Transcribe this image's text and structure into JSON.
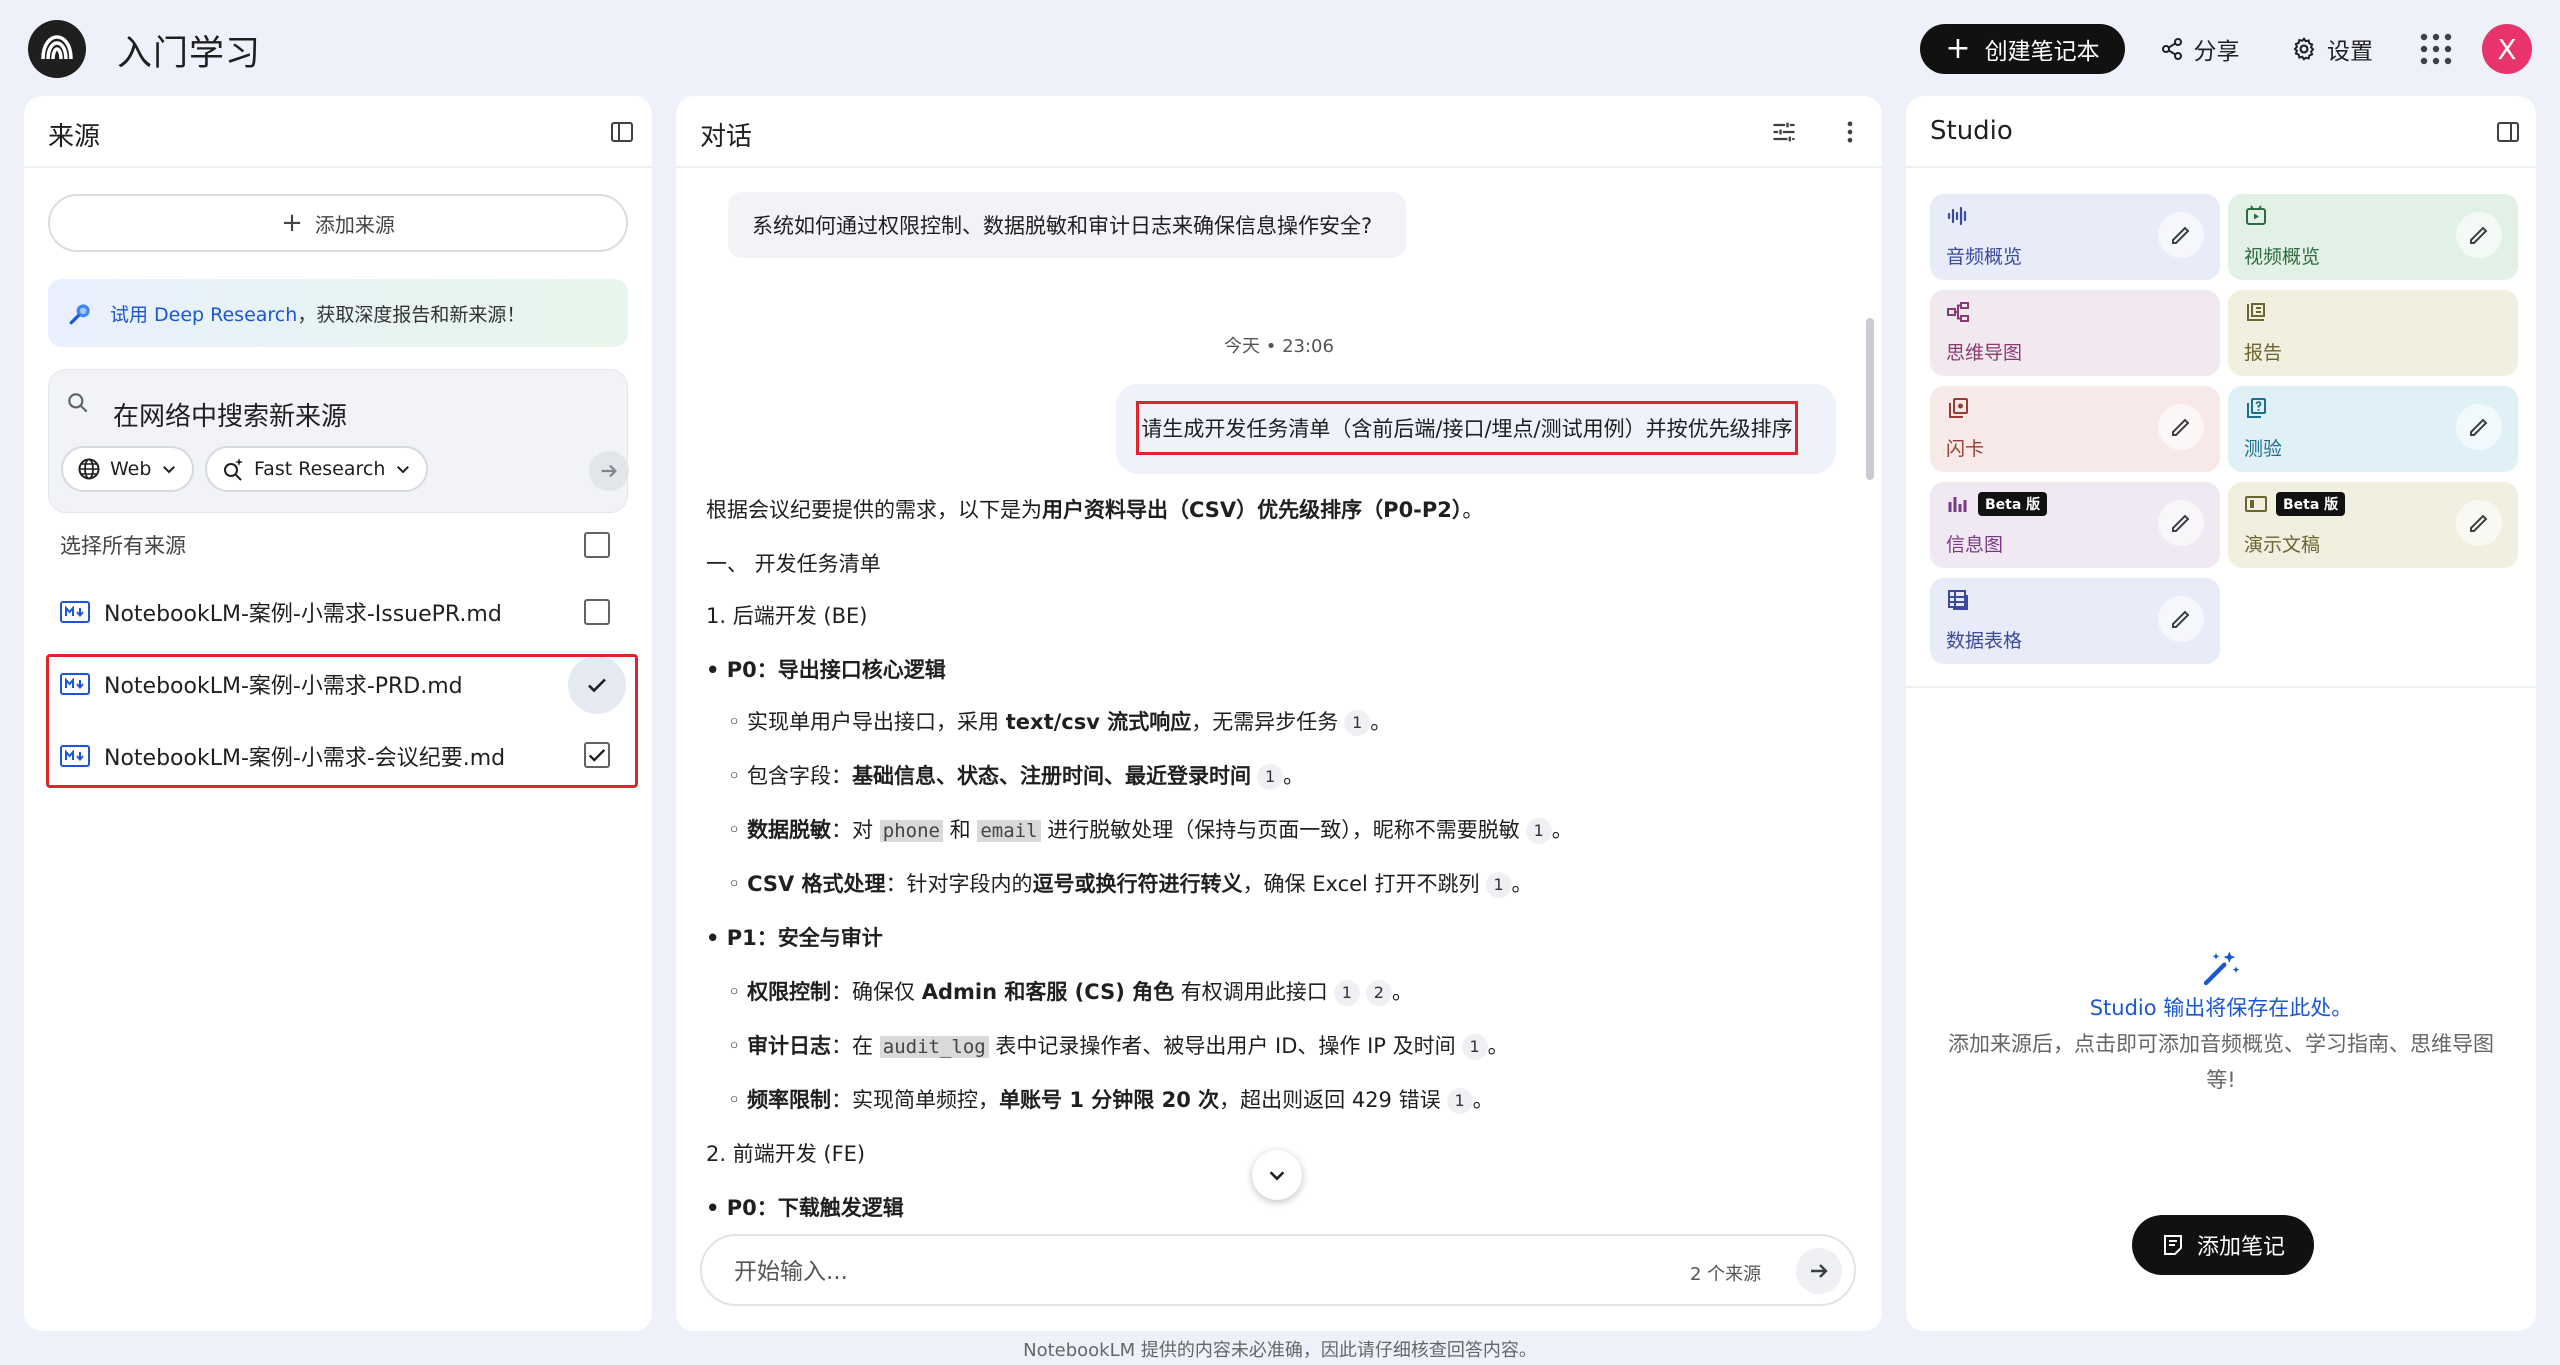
{
  "header": {
    "notebook_title": "入门学习",
    "create_label": "创建笔记本",
    "share_label": "分享",
    "settings_label": "设置",
    "avatar_letter": "X"
  },
  "sources": {
    "title": "来源",
    "add_label": "添加来源",
    "deep_link": "试用 Deep Research",
    "deep_text": "，获取深度报告和新来源！",
    "search_placeholder": "在网络中搜索新来源",
    "chip_web": "Web",
    "chip_research": "Fast Research",
    "select_all": "选择所有来源",
    "items": [
      {
        "name": "NotebookLM-案例-小需求-IssuePR.md",
        "checked": false
      },
      {
        "name": "NotebookLM-案例-小需求-PRD.md",
        "checked": true
      },
      {
        "name": "NotebookLM-案例-小需求-会议纪要.md",
        "checked": true
      }
    ]
  },
  "chat": {
    "title": "对话",
    "user_q1": "系统如何通过权限控制、数据脱敏和审计日志来确保信息操作安全?",
    "timestamp": "今天 • 23:06",
    "user_q2": "请生成开发任务清单（含前后端/接口/埋点/测试用例）并按优先级排序",
    "answer": {
      "intro_pre": "根据会议纪要提供的需求，以下是为",
      "intro_bold": "用户资料导出（CSV）优先级排序（P0-P2）",
      "intro_post": "。",
      "sec1": "一、 开发任务清单",
      "sub1": "1. 后端开发 (BE)",
      "p0": "• P0：导出接口核心逻辑",
      "p0_items": {
        "a_pre": "◦ 实现单用户导出接口，采用 ",
        "a_bold": "text/csv 流式响应",
        "a_post": "，无需异步任务",
        "b_pre": "◦ 包含字段：",
        "b_bold": "基础信息、状态、注册时间、最近登录时间",
        "c_bold": "数据脱敏",
        "c_pre": "：对 ",
        "c_code1": "phone",
        "c_mid": " 和 ",
        "c_code2": "email",
        "c_post": " 进行脱敏处理（保持与页面一致），昵称不需要脱敏",
        "d_bold": "CSV 格式处理",
        "d_pre": "：针对字段内的",
        "d_bold2": "逗号或换行符进行转义",
        "d_post": "，确保 Excel 打开不跳列"
      },
      "p1": "• P1：安全与审计",
      "p1_items": {
        "a_bold": "权限控制",
        "a_pre": "：确保仅 ",
        "a_bold2": "Admin 和客服 (CS) 角色",
        "a_post": " 有权调用此接口",
        "b_bold": "审计日志",
        "b_pre": "：在 ",
        "b_code": "audit_log",
        "b_post": " 表中记录操作者、被导出用户 ID、操作 IP 及时间",
        "c_bold": "频率限制",
        "c_pre": "：实现简单频控，",
        "c_bold2": "单账号 1 分钟限 20 次",
        "c_post": "，超出则返回 429 错误"
      },
      "sub2": "2. 前端开发 (FE)",
      "p0b": "• P0：下载触发逻辑",
      "cite1": "1",
      "cite2": "2"
    },
    "input_placeholder": "开始输入...",
    "source_count": "2 个来源"
  },
  "studio": {
    "title": "Studio",
    "tiles": [
      {
        "label": "音频概览",
        "bg": "#e8ecf8",
        "color": "#3b4aa0",
        "icon": "audio-wave-icon",
        "edit": true
      },
      {
        "label": "视频概览",
        "bg": "#e2f1e6",
        "color": "#2e6b3f",
        "icon": "video-play-icon",
        "edit": true
      },
      {
        "label": "思维导图",
        "bg": "#f2e8f0",
        "color": "#8a3a6e",
        "icon": "mind-map-icon",
        "edit": false
      },
      {
        "label": "报告",
        "bg": "#f1efe0",
        "color": "#6b6630",
        "icon": "report-icon",
        "edit": false
      },
      {
        "label": "闪卡",
        "bg": "#f7e9e8",
        "color": "#9a3b32",
        "icon": "flashcard-icon",
        "edit": true
      },
      {
        "label": "测验",
        "bg": "#dff0f7",
        "color": "#1f6d8a",
        "icon": "quiz-icon",
        "edit": true
      },
      {
        "label": "信息图",
        "bg": "#f0e8f2",
        "color": "#7a3a8a",
        "icon": "infographic-icon",
        "edit": true,
        "beta": "Beta 版"
      },
      {
        "label": "演示文稿",
        "bg": "#f1efe0",
        "color": "#6b6630",
        "icon": "slides-icon",
        "edit": true,
        "beta": "Beta 版"
      },
      {
        "label": "数据表格",
        "bg": "#e8ecf8",
        "color": "#3b4aa0",
        "icon": "data-table-icon",
        "edit": true
      }
    ],
    "empty_title": "Studio 输出将保存在此处。",
    "empty_desc": "添加来源后，点击即可添加音频概览、学习指南、思维导图等!",
    "add_note_label": "添加笔记"
  },
  "footer": "NotebookLM 提供的内容未必准确，因此请仔细核查回答内容。"
}
